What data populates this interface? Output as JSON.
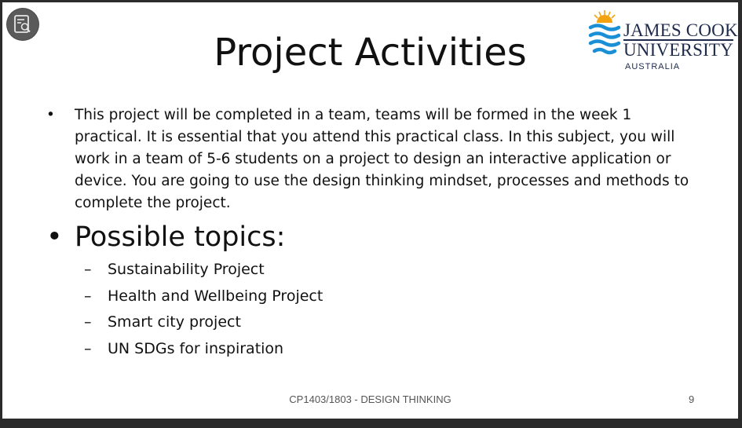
{
  "slide": {
    "title": "Project Activities",
    "bullet1": "This project will be completed in a team, teams will be formed in the week 1 practical. It is essential that you attend this practical class. In this subject, you will work in a team of 5-6 students on a project to design an interactive application or device. You are going to use the design thinking mindset, processes and methods to complete the project.",
    "bullet2": "Possible topics:",
    "sub_items": [
      "Sustainability Project",
      "Health and Wellbeing Project",
      "Smart city project",
      "UN SDGs for inspiration"
    ],
    "footer": "CP1403/1803 - DESIGN THINKING",
    "page_number": "9"
  },
  "logo": {
    "line1": "JAMES COOK",
    "line2": "UNIVERSITY",
    "line3": "AUSTRALIA"
  },
  "viewer": {
    "icon": "document-search-icon"
  },
  "colors": {
    "logo_blue": "#1b8fd6",
    "logo_sun": "#f2a30f",
    "logo_text": "#1d2a4a"
  }
}
